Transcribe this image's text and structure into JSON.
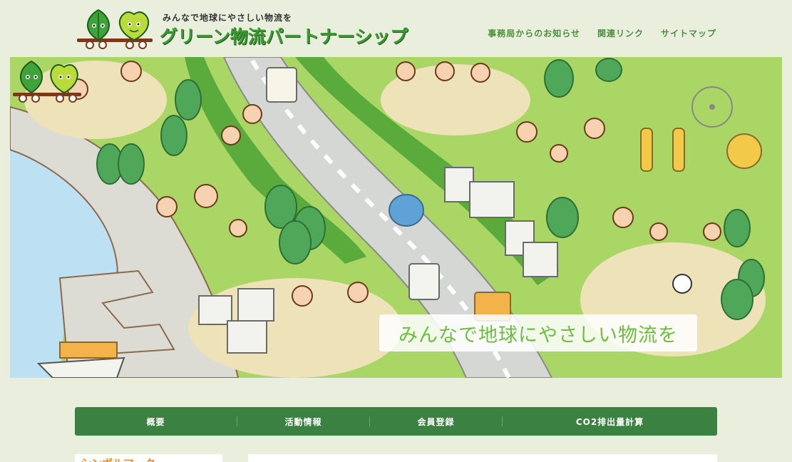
{
  "header": {
    "tagline": "みんなで地球にやさしい物流を",
    "title": "グリーン物流パートナーシップ",
    "nav": [
      {
        "label": "事務局からのお知らせ"
      },
      {
        "label": "関連リンク"
      },
      {
        "label": "サイトマップ"
      }
    ]
  },
  "hero": {
    "caption": "みんなで地球にやさしい物流を"
  },
  "main_nav": [
    {
      "label": "概要"
    },
    {
      "label": "活動情報"
    },
    {
      "label": "会員登録"
    },
    {
      "label": "CO2排出量計算"
    }
  ],
  "sidebar": {
    "heading": "シンボルマーク"
  },
  "colors": {
    "page_bg": "#eaefdd",
    "brand_green": "#3c9a33",
    "nav_bg": "#3a8142",
    "accent_orange": "#f08a1d"
  }
}
